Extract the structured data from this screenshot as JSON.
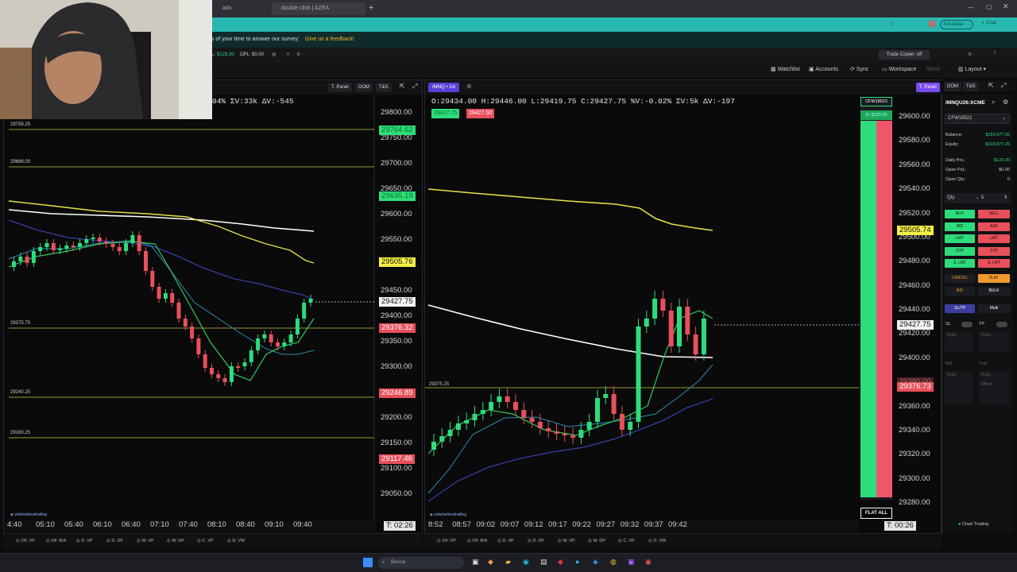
{
  "browser": {
    "tabs": [
      "ado",
      "double click | AZÉA"
    ],
    "update_btn": "Actualizar",
    "chat_btn": "Chat"
  },
  "survey": {
    "text": "es of your time to answer our survey:",
    "link": "Give us a feedback!"
  },
  "account_bar": {
    "pl_label": "PL:",
    "pl_value": "$123.30",
    "opl_label": "OPL:",
    "opl_value": "$0.00",
    "trade_copier": "Trade Copier: off"
  },
  "toolbar": {
    "watchlist": "Watchlist",
    "accounts": "Accounts",
    "sync": "Sync",
    "workspace": "Workspace",
    "item2": "Item2",
    "layout": "Layout"
  },
  "left_chart": {
    "header_stats": "04%  ΣV:33k  ΔV:-545",
    "buttons": [
      "T. Panel",
      "DOM",
      "T&S"
    ],
    "price_labels": [
      "29800.00",
      "29750.00",
      "29700.00",
      "29650.00",
      "29600.00",
      "29550.00",
      "29450.00",
      "29400.00",
      "29350.00",
      "29300.00",
      "29200.00",
      "29150.00",
      "29100.00",
      "29050.00"
    ],
    "levels": [
      "29759.25",
      "29686.00",
      "29375.75",
      "29240.25",
      "29160.25"
    ],
    "tags": {
      "green_top": "29764.62",
      "green_mid": "29635.19",
      "yellow": "29505.76",
      "current": "29427.75",
      "red1": "29376.32",
      "red2": "29246.89",
      "red3": "29117.46"
    },
    "time_labels": [
      "4:40",
      "05:10",
      "05:40",
      "06:10",
      "06:40",
      "07:10",
      "07:40",
      "08:10",
      "08:40",
      "09:10",
      "09:40"
    ],
    "timer": "T: 02:26",
    "logo": "volumetricatrading",
    "bottom_items": [
      "OF. VP",
      "OF. B/A",
      "D. VP",
      "D. DP",
      "W. VP",
      "W. DP",
      "C. VP",
      "D. VW"
    ]
  },
  "right_chart": {
    "symbol_tab": "/MNQ • 1m",
    "header_stats": "O:29434.00  H:29446.00  L:29419.75  C:29427.75  %V:-0.02%  ΣV:5k  ΔV:-197",
    "bid_tag": "29427.75",
    "ask_tag": "29427.50",
    "buttons": [
      "T. Panel",
      "DOM",
      "T&S"
    ],
    "price_labels": [
      "29600.00",
      "29580.00",
      "29560.00",
      "29540.00",
      "29520.00",
      "29500.00",
      "29480.00",
      "29460.00",
      "29440.00",
      "29420.00",
      "29400.00",
      "29360.00",
      "29340.00",
      "29320.00",
      "29300.00",
      "29280.00"
    ],
    "level": "29375.25",
    "tags": {
      "yellow": "29505.74",
      "current": "29427.75",
      "red": "29376.73",
      "red_faded": "29380.00"
    },
    "time_labels": [
      "8:52",
      "08:57",
      "09:02",
      "09:07",
      "09:12",
      "09:17",
      "09:22",
      "09:27",
      "09:32",
      "09:37",
      "09:42"
    ],
    "timer": "T: 00:26",
    "account_tag": "CFW18522",
    "pnl_tag": "D: $123.30",
    "flat_all": "FLAT ALL",
    "logo": "volumetricatrading",
    "bottom_items": [
      "OF. VP",
      "OF. B/A",
      "D. VP",
      "D. DP",
      "W. VP",
      "W. DP",
      "C. VP",
      "D. VW"
    ]
  },
  "trade_panel": {
    "symbol": "/MNQU26:XCME",
    "account": "CFW18522",
    "rows": [
      {
        "k": "Balance:",
        "v": "$153,877.26"
      },
      {
        "k": "Equity:",
        "v": "$103,877.26"
      },
      {
        "k": "Daily PnL:",
        "v": "$123.30"
      },
      {
        "k": "Open PnL:",
        "v": "$0.00"
      },
      {
        "k": "Open Qty:",
        "v": "0"
      }
    ],
    "qty_label": "Qty",
    "qty_value": "5",
    "orders": [
      [
        "BUY",
        "SELL"
      ],
      [
        "BID",
        "ASK"
      ],
      [
        "LMT",
        "LMT"
      ],
      [
        "STP",
        "STP"
      ],
      [
        "S. LMT",
        "S. LMT"
      ]
    ],
    "cancel": "CANCEL",
    "flat": "FLAT",
    "be": "B/E",
    "bulk": "BULK",
    "sltp": "SL/TP",
    "multi": "Multi",
    "sl": "SL",
    "tp": "TP",
    "ticks": "Ticks",
    "be2": "B/E",
    "trail": "Trail",
    "offset": "Offset",
    "chart_trading": "Chart Trading"
  },
  "taskbar": {
    "search": "Buscar"
  },
  "colors": {
    "green": "#2edc7c",
    "red": "#e8505b",
    "yellow": "#f2f047",
    "accent": "#28b8b2",
    "purple": "#6a4cf0"
  }
}
